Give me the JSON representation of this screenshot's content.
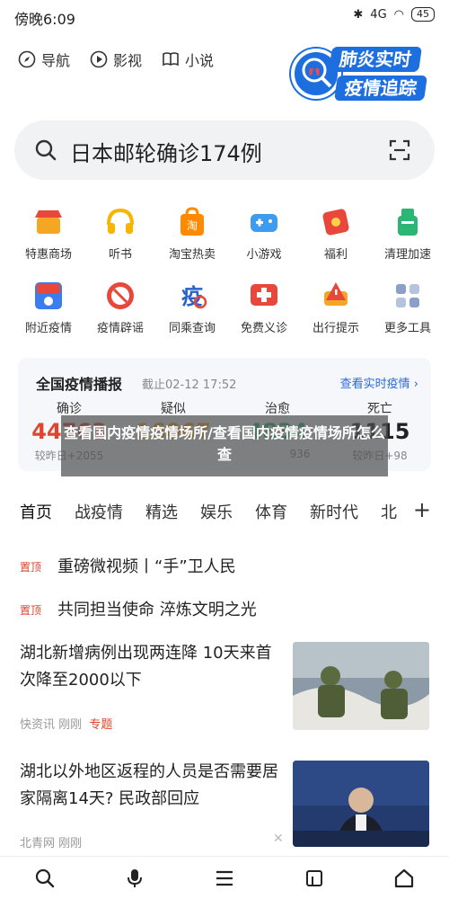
{
  "status_bar": {
    "time": "傍晚6:09",
    "battery": "45",
    "signal": "4G",
    "colors": {
      "text": "#222222"
    }
  },
  "top_links": [
    {
      "label": "导航",
      "icon": "compass-icon"
    },
    {
      "label": "影视",
      "icon": "play-circle-icon"
    },
    {
      "label": "小说",
      "icon": "book-icon"
    }
  ],
  "logo": {
    "line1": "肺炎实时",
    "line2": "疫情追踪",
    "icon": "lungs-icon"
  },
  "search": {
    "text": "日本邮轮确诊174例",
    "icon": "search-icon",
    "scan_icon": "scan-icon"
  },
  "grid": [
    {
      "label": "特惠商场",
      "icon": "shop-icon",
      "color": "#f5a623"
    },
    {
      "label": "听书",
      "icon": "headphones-icon",
      "color": "#f7b500"
    },
    {
      "label": "淘宝热卖",
      "icon": "taobao-bag-icon",
      "color": "#ff8a00"
    },
    {
      "label": "小游戏",
      "icon": "gamepad-icon",
      "color": "#3d9cf0"
    },
    {
      "label": "福利",
      "icon": "gift-card-icon",
      "color": "#e8473b"
    },
    {
      "label": "清理加速",
      "icon": "clean-icon",
      "color": "#2bb673"
    },
    {
      "label": "附近疫情",
      "icon": "nearby-icon",
      "color": "#3b7df0"
    },
    {
      "label": "疫情辟谣",
      "icon": "rumor-icon",
      "color": "#e8473b"
    },
    {
      "label": "同乘查询",
      "icon": "same-trip-icon",
      "color": "#2a62c9"
    },
    {
      "label": "免费义诊",
      "icon": "medical-icon",
      "color": "#e8473b"
    },
    {
      "label": "出行提示",
      "icon": "travel-alert-icon",
      "color": "#f5a623"
    },
    {
      "label": "更多工具",
      "icon": "more-grid-icon",
      "color": "#8aa0c8"
    }
  ],
  "covid_card": {
    "title": "全国疫情播报",
    "date": "截止02-12 17:52",
    "more": "查看实时疫情",
    "stats": [
      {
        "label": "确诊",
        "value": "44763",
        "change": "较昨日+2055",
        "color": "#e0442f"
      },
      {
        "label": "疑似",
        "value": "16067",
        "change": "",
        "color": "#f5a623"
      },
      {
        "label": "治愈",
        "value": "4834",
        "change": "936",
        "color": "#2bb673"
      },
      {
        "label": "死亡",
        "value": "1115",
        "change": "较昨日+98",
        "color": "#333333"
      }
    ]
  },
  "overlay": {
    "text": "查看国内疫情疫情场所/查看国内疫情疫情场所怎么查"
  },
  "tabs": [
    "首页",
    "战疫情",
    "精选",
    "娱乐",
    "体育",
    "新时代",
    "北"
  ],
  "pinned": [
    {
      "tag": "置顶",
      "title": "重磅微视频丨“手”卫人民"
    },
    {
      "tag": "置顶",
      "title": "共同担当使命 淬炼文明之光"
    }
  ],
  "news": [
    {
      "title": "湖北新增病例出现两连降 10天来首次降至2000以下",
      "source": "快资讯",
      "time": "刚刚",
      "tag": "专题"
    },
    {
      "title": "湖北以外地区返程的人员是否需要居家隔离14天? 民政部回应",
      "source": "北青网",
      "time": "刚刚",
      "tag": ""
    }
  ],
  "bottom_nav": [
    "search-icon",
    "microphone-icon",
    "menu-icon",
    "tabs-icon",
    "home-icon"
  ]
}
